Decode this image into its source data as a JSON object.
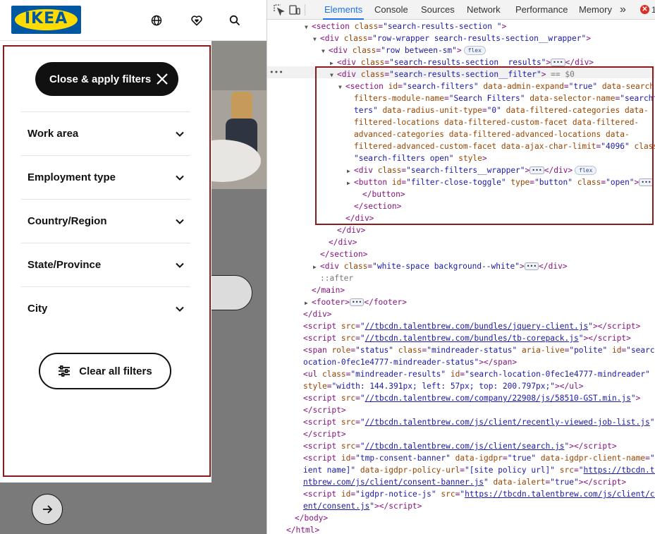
{
  "site": {
    "logo_text": "IKEA",
    "header_icons": [
      "globe-icon",
      "heart-icon",
      "search-icon"
    ]
  },
  "filters": {
    "close_apply_label": "Close & apply filters",
    "rows": [
      {
        "label": "Work area"
      },
      {
        "label": "Employment type"
      },
      {
        "label": "Country/Region"
      },
      {
        "label": "State/Province"
      },
      {
        "label": "City"
      }
    ],
    "clear_all_label": "Clear all filters"
  },
  "devtools": {
    "tabs": [
      "Elements",
      "Console",
      "Sources",
      "Network",
      "Performance",
      "Memory"
    ],
    "active_tab": "Elements",
    "more_label": "»",
    "error_count": "1",
    "selected_marker": "== $0",
    "lines": [
      {
        "indent": 0,
        "tri": "open",
        "html": "<span class='t'>&lt;section</span> <span class='a'>class</span>=<span class='v'>\"search-results-section \"</span><span class='t'>&gt;</span>"
      },
      {
        "indent": 1,
        "tri": "open",
        "html": "<span class='t'>&lt;div</span> <span class='a'>class</span>=<span class='v'>\"row-wrapper search-results-section__wrapper\"</span><span class='t'>&gt;</span>"
      },
      {
        "indent": 2,
        "tri": "open",
        "html": "<span class='t'>&lt;div</span> <span class='a'>class</span>=<span class='v'>\"row between-sm\"</span><span class='t'>&gt;</span>",
        "badge": "flex"
      },
      {
        "indent": 3,
        "tri": "closed",
        "html": "<span class='t'>&lt;div</span> <span class='a'>class</span>=<span class='v'>\"search-results-section__results\"</span><span class='t'>&gt;</span>",
        "ellipsis": true,
        "tail": "<span class='t'>&lt;/div&gt;</span>"
      },
      {
        "indent": 3,
        "tri": "open",
        "html": "<span class='t'>&lt;div</span> <span class='a'>class</span>=<span class='v'>\"search-results-section__filter\"</span><span class='t'>&gt;</span>",
        "selected": true
      },
      {
        "indent": 4,
        "tri": "open",
        "html": "<span class='t'>&lt;section</span> <span class='a'>id</span>=<span class='v'>\"search-filters\"</span> <span class='a'>data-admin-expand</span>=<span class='v'>\"true\"</span> <span class='a'>data-search-</span>"
      },
      {
        "indent": 5,
        "tri": "none",
        "html": "<span class='a'>filters-module-name</span>=<span class='v'>\"Search Filters\"</span> <span class='a'>data-selector-name</span>=<span class='v'>\"searchfil</span>"
      },
      {
        "indent": 5,
        "tri": "none",
        "html": "<span class='v'>ters\"</span> <span class='a'>data-radius-unit-type</span>=<span class='v'>\"0\"</span> <span class='a'>data-filtered-categories</span> <span class='a'>data-</span>"
      },
      {
        "indent": 5,
        "tri": "none",
        "html": "<span class='a'>filtered-locations</span> <span class='a'>data-filtered-custom-facet</span> <span class='a'>data-filtered-</span>"
      },
      {
        "indent": 5,
        "tri": "none",
        "html": "<span class='a'>advanced-categories</span> <span class='a'>data-filtered-advanced-locations</span> <span class='a'>data-</span>"
      },
      {
        "indent": 5,
        "tri": "none",
        "html": "<span class='a'>filtered-advanced-custom-facet</span> <span class='a'>data-ajax-char-limit</span>=<span class='v'>\"4096\"</span> <span class='a'>class</span>=<span class='v'></span>"
      },
      {
        "indent": 5,
        "tri": "none",
        "html": "<span class='v'>\"search-filters open\"</span> <span class='a'>style</span><span class='t'>&gt;</span>"
      },
      {
        "indent": 5,
        "tri": "closed",
        "html": "<span class='t'>&lt;div</span> <span class='a'>class</span>=<span class='v'>\"search-filters__wrapper\"</span><span class='t'>&gt;</span>",
        "ellipsis": true,
        "tail": "<span class='t'>&lt;/div&gt;</span>",
        "badge": "flex"
      },
      {
        "indent": 5,
        "tri": "closed",
        "html": "<span class='t'>&lt;button</span> <span class='a'>id</span>=<span class='v'>\"filter-close-toggle\"</span> <span class='a'>type</span>=<span class='v'>\"button\"</span> <span class='a'>class</span>=<span class='v'>\"open\"</span><span class='t'>&gt;</span>",
        "ellipsis": true
      },
      {
        "indent": 6,
        "tri": "none",
        "html": "<span class='t'>&lt;/button&gt;</span>"
      },
      {
        "indent": 5,
        "tri": "none",
        "html": "<span class='t'>&lt;/section&gt;</span>"
      },
      {
        "indent": 4,
        "tri": "none",
        "html": "<span class='t'>&lt;/div&gt;</span>"
      },
      {
        "indent": 3,
        "tri": "none",
        "html": "<span class='t'>&lt;/div&gt;</span>"
      },
      {
        "indent": 2,
        "tri": "none",
        "html": "<span class='t'>&lt;/div&gt;</span>"
      },
      {
        "indent": 1,
        "tri": "none",
        "html": "<span class='t'>&lt;/section&gt;</span>"
      },
      {
        "indent": 1,
        "tri": "closed",
        "html": "<span class='t'>&lt;div</span> <span class='a'>class</span>=<span class='v'>\"white-space background--white\"</span><span class='t'>&gt;</span>",
        "ellipsis": true,
        "tail": "<span class='t'>&lt;/div&gt;</span>"
      },
      {
        "indent": 1,
        "tri": "none",
        "html": "<span class='c'>::after</span>"
      },
      {
        "indent": 0,
        "tri": "none",
        "html": "<span class='t'>&lt;/main&gt;</span>"
      },
      {
        "indent": 0,
        "tri": "closed",
        "html": "<span class='t'>&lt;footer&gt;</span>",
        "ellipsis": true,
        "tail": "<span class='t'>&lt;/footer&gt;</span>"
      },
      {
        "indent": -1,
        "tri": "none",
        "html": "<span class='t'>&lt;/div&gt;</span>"
      },
      {
        "indent": -1,
        "tri": "none",
        "html": "<span class='t'>&lt;script</span> <span class='a'>src</span>=<span class='v'>\"</span><span class='lnk'>//tbcdn.talentbrew.com/bundles/jquery-client.js</span><span class='v'>\"</span><span class='t'>&gt;&lt;/script&gt;</span>"
      },
      {
        "indent": -1,
        "tri": "none",
        "html": "<span class='t'>&lt;script</span> <span class='a'>src</span>=<span class='v'>\"</span><span class='lnk'>//tbcdn.talentbrew.com/bundles/tb-corepack.js</span><span class='v'>\"</span><span class='t'>&gt;&lt;/script&gt;</span>"
      },
      {
        "indent": -1,
        "tri": "none",
        "html": "<span class='t'>&lt;span</span> <span class='a'>role</span>=<span class='v'>\"status\"</span> <span class='a'>class</span>=<span class='v'>\"mindreader-status\"</span> <span class='a'>aria-live</span>=<span class='v'>\"polite\"</span> <span class='a'>id</span>=<span class='v'>\"search-l</span>"
      },
      {
        "indent": -1,
        "tri": "none",
        "html": "<span class='v'>ocation-0fec1e4777-mindreader-status\"</span><span class='t'>&gt;&lt;/span&gt;</span>"
      },
      {
        "indent": -1,
        "tri": "none",
        "html": "<span class='t'>&lt;ul</span> <span class='a'>class</span>=<span class='v'>\"mindreader-results\"</span> <span class='a'>id</span>=<span class='v'>\"search-location-0fec1e4777-mindreader\"</span>"
      },
      {
        "indent": -1,
        "tri": "none",
        "html": "<span class='a'>style</span>=<span class='v'>\"width: 144.391px; left: 57px; top: 200.797px;\"</span><span class='t'>&gt;&lt;/ul&gt;</span>"
      },
      {
        "indent": -1,
        "tri": "none",
        "html": "<span class='t'>&lt;script</span> <span class='a'>src</span>=<span class='v'>\"</span><span class='lnk'>//tbcdn.talentbrew.com/company/22908/js/58510-GST.min.js</span><span class='v'>\"</span><span class='t'>&gt;</span>"
      },
      {
        "indent": -1,
        "tri": "none",
        "html": "<span class='t'>&lt;/script&gt;</span>"
      },
      {
        "indent": -1,
        "tri": "none",
        "html": "<span class='t'>&lt;script</span> <span class='a'>src</span>=<span class='v'>\"</span><span class='lnk'>//tbcdn.talentbrew.com/js/client/recently-viewed-job-list.js</span><span class='v'>\"</span><span class='t'>&gt;</span>"
      },
      {
        "indent": -1,
        "tri": "none",
        "html": "<span class='t'>&lt;/script&gt;</span>"
      },
      {
        "indent": -1,
        "tri": "none",
        "html": "<span class='t'>&lt;script</span> <span class='a'>src</span>=<span class='v'>\"</span><span class='lnk'>//tbcdn.talentbrew.com/js/client/search.js</span><span class='v'>\"</span><span class='t'>&gt;&lt;/script&gt;</span>"
      },
      {
        "indent": -1,
        "tri": "none",
        "html": "<span class='t'>&lt;script</span> <span class='a'>id</span>=<span class='v'>\"tmp-consent-banner\"</span> <span class='a'>data-igdpr</span>=<span class='v'>\"true\"</span> <span class='a'>data-igdpr-client-name</span>=<span class='v'>\"[cl</span>"
      },
      {
        "indent": -1,
        "tri": "none",
        "html": "<span class='v'>ient name]\"</span> <span class='a'>data-igdpr-policy-url</span>=<span class='v'>\"[site policy url]\"</span> <span class='a'>src</span>=<span class='v'>\"</span><span class='lnk'>https://tbcdn.tale</span>"
      },
      {
        "indent": -1,
        "tri": "none",
        "html": "<span class='lnk'>ntbrew.com/js/client/consent-banner.js</span><span class='v'>\"</span> <span class='a'>data-ialert</span>=<span class='v'>\"true\"</span><span class='t'>&gt;&lt;/script&gt;</span>"
      },
      {
        "indent": -1,
        "tri": "none",
        "html": "<span class='t'>&lt;script</span> <span class='a'>id</span>=<span class='v'>\"igdpr-notice-js\"</span> <span class='a'>src</span>=<span class='v'>\"</span><span class='lnk'>https://tbcdn.talentbrew.com/js/client/cons</span>"
      },
      {
        "indent": -1,
        "tri": "none",
        "html": "<span class='lnk'>ent/consent.js</span><span class='v'>\"</span><span class='t'>&gt;&lt;/script&gt;</span>"
      },
      {
        "indent": -2,
        "tri": "none",
        "html": "<span class='t'>&lt;/body&gt;</span>"
      },
      {
        "indent": -3,
        "tri": "none",
        "html": "<span class='t'>&lt;/html&gt;</span>"
      }
    ]
  },
  "colors": {
    "ikea_blue": "#0058a3",
    "ikea_yellow": "#ffdb00",
    "highlight_border": "#8b1a1a",
    "devtools_accent": "#1a73e8"
  }
}
